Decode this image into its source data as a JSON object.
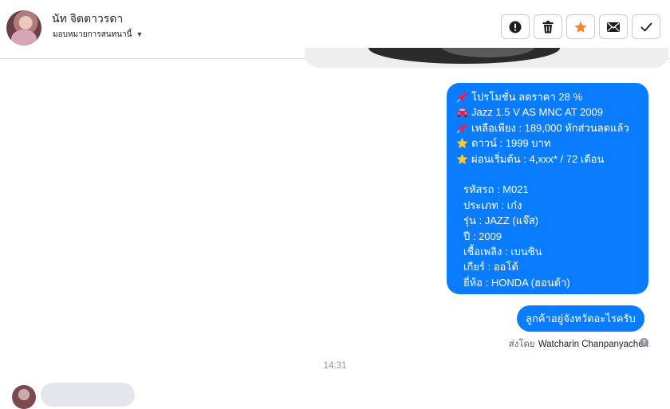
{
  "header": {
    "contact_name": "นัท จิตตาวรดา",
    "assign_label": "มอบหมายการสนทนานี้",
    "actions": [
      {
        "name": "mark-spam",
        "icon": "exclamation-circle-icon"
      },
      {
        "name": "delete",
        "icon": "trash-icon"
      },
      {
        "name": "star",
        "icon": "star-icon",
        "color": "#f5842a"
      },
      {
        "name": "mark-unread",
        "icon": "envelope-icon"
      },
      {
        "name": "mark-done",
        "icon": "checkmark-icon"
      }
    ]
  },
  "messages": {
    "promo": {
      "lines": [
        {
          "icon": "pushpin-icon",
          "text": "โปรโมชั่น ลดราคา 28 %"
        },
        {
          "icon": "car-icon",
          "text": "Jazz 1.5 V AS MNC AT 2009"
        },
        {
          "icon": "pushpin-icon",
          "text": "เหลือเพียง : 189,000 หักส่วนลดแล้ว"
        },
        {
          "icon": "star-icon",
          "text": "ดาวน์ : 1999 บาท"
        },
        {
          "icon": "star-icon",
          "text": "ผ่อนเริ่มต้น : 4,xxx* / 72 เดือน"
        }
      ],
      "details": [
        "รหัสรถ : M021",
        "ประเภท : เก๋ง",
        "รุ่น : JAZZ (แจ๊ส)",
        "ปี : 2009",
        "เชื้อเพลิง : เบนซิน",
        "เกียร์ : ออโต้",
        "ยี่ห้อ : HONDA (ฮอนด้า)"
      ]
    },
    "question": "ลูกค้าอยู่จังหวัดอะไรครับ",
    "sent_by_label": "ส่งโดย",
    "sent_by_name": "Watcharin Chanpanyachon",
    "time": "14:31"
  },
  "colors": {
    "bubble_blue": "#0a7cff",
    "star_orange": "#f5842a"
  }
}
